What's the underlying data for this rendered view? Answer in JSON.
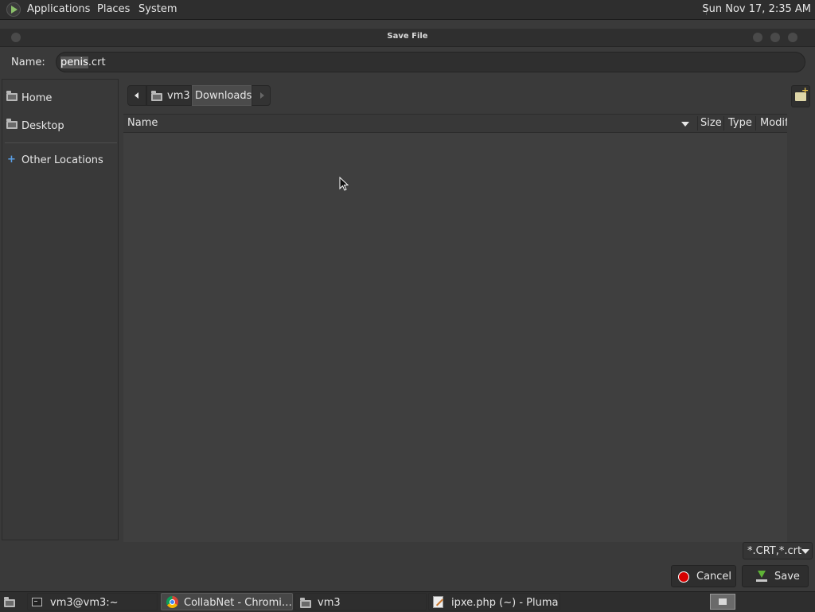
{
  "top_panel": {
    "menus": [
      "Applications",
      "Places",
      "System"
    ],
    "clock": "Sun Nov 17,  2:35 AM"
  },
  "dialog": {
    "title": "Save File",
    "name_label": "Name:",
    "name_value_selected": "penis",
    "name_value_rest": ".crt",
    "sidebar": {
      "home": "Home",
      "desktop": "Desktop",
      "other_locations": "Other Locations"
    },
    "pathbar": {
      "crumb1": "vm3",
      "crumb2": "Downloads"
    },
    "columns": {
      "name": "Name",
      "size": "Size",
      "type": "Type",
      "modified": "Modif"
    },
    "filter": "*.CRT,*.crt",
    "buttons": {
      "cancel": "Cancel",
      "save": "Save"
    }
  },
  "taskbar": {
    "tasks": [
      "vm3@vm3:~",
      "CollabNet - Chromi…",
      "vm3",
      "ipxe.php (~) - Pluma"
    ]
  },
  "colors": {
    "panel_bg": "#2e2e2e",
    "dialog_bg": "#3a3a3a",
    "list_bg": "#3f3f3f",
    "cancel_icon": "#d60000",
    "save_icon": "#5fb336",
    "link_accent": "#5aa0e6"
  },
  "icons": {
    "app_logo": "mate-menu-icon",
    "sidebar_home": "home-folder-icon",
    "sidebar_desktop": "desktop-folder-icon",
    "sidebar_other": "plus-icon",
    "new_folder": "new-folder-icon",
    "cancel": "cancel-icon",
    "save": "save-download-icon"
  }
}
